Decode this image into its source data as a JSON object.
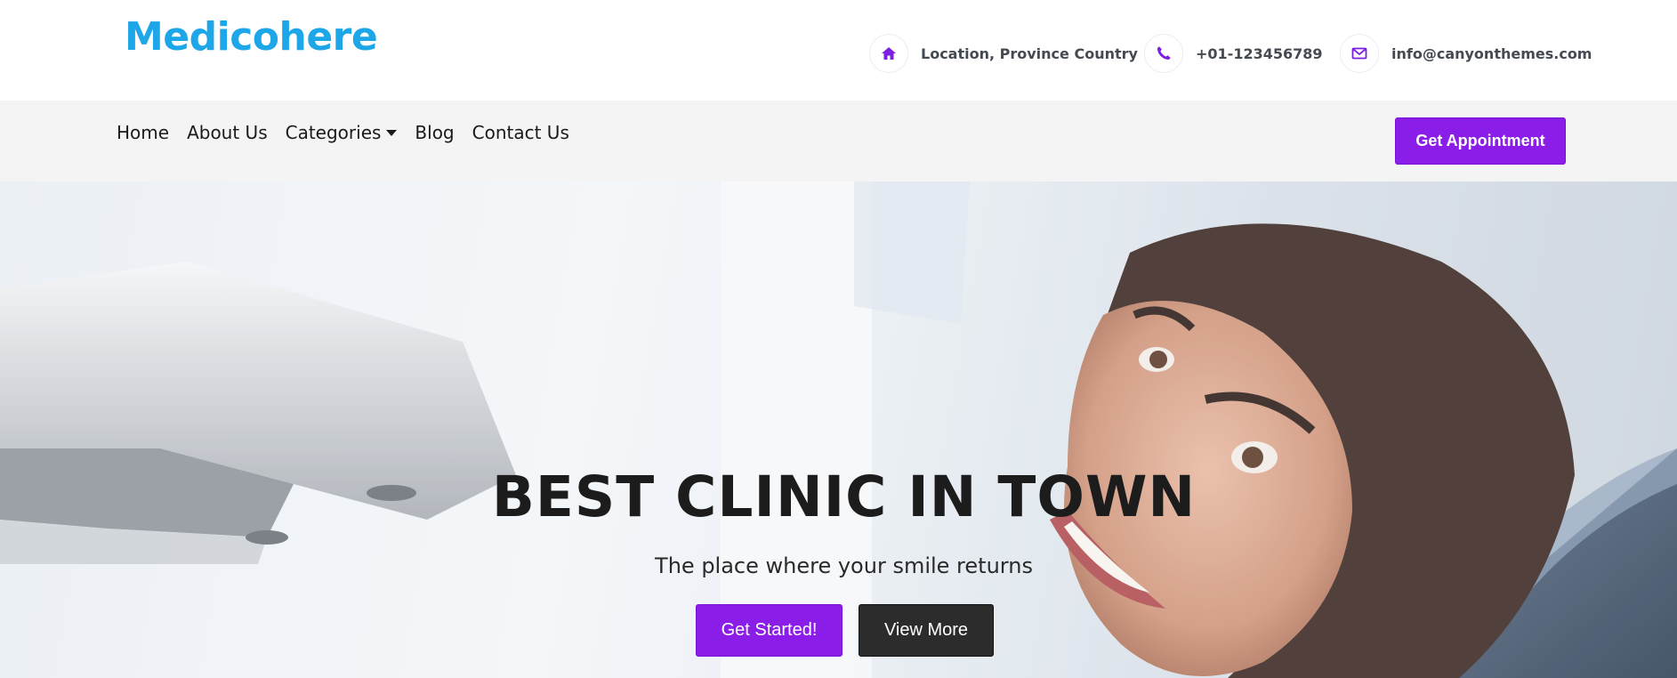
{
  "brand": {
    "logo_text": "Medicohere",
    "accent": "#1ea7e8"
  },
  "contacts": [
    {
      "icon": "home-icon",
      "text": "Location, Province Country"
    },
    {
      "icon": "phone-icon",
      "text": "+01-123456789"
    },
    {
      "icon": "envelope-icon",
      "text": "info@canyonthemes.com"
    }
  ],
  "nav": {
    "items": [
      {
        "label": "Home"
      },
      {
        "label": "About Us"
      },
      {
        "label": "Categories",
        "has_dropdown": true
      },
      {
        "label": "Blog"
      },
      {
        "label": "Contact Us"
      }
    ],
    "cta_label": "Get Appointment"
  },
  "hero": {
    "title": "BEST CLINIC IN TOWN",
    "subtitle": "The place where your smile returns",
    "primary_label": "Get Started!",
    "secondary_label": "View More"
  },
  "colors": {
    "primary": "#8a1ee8",
    "dark_button": "#2c2c2c",
    "icon": "#7b1fe0",
    "nav_bg": "#f4f4f4"
  }
}
